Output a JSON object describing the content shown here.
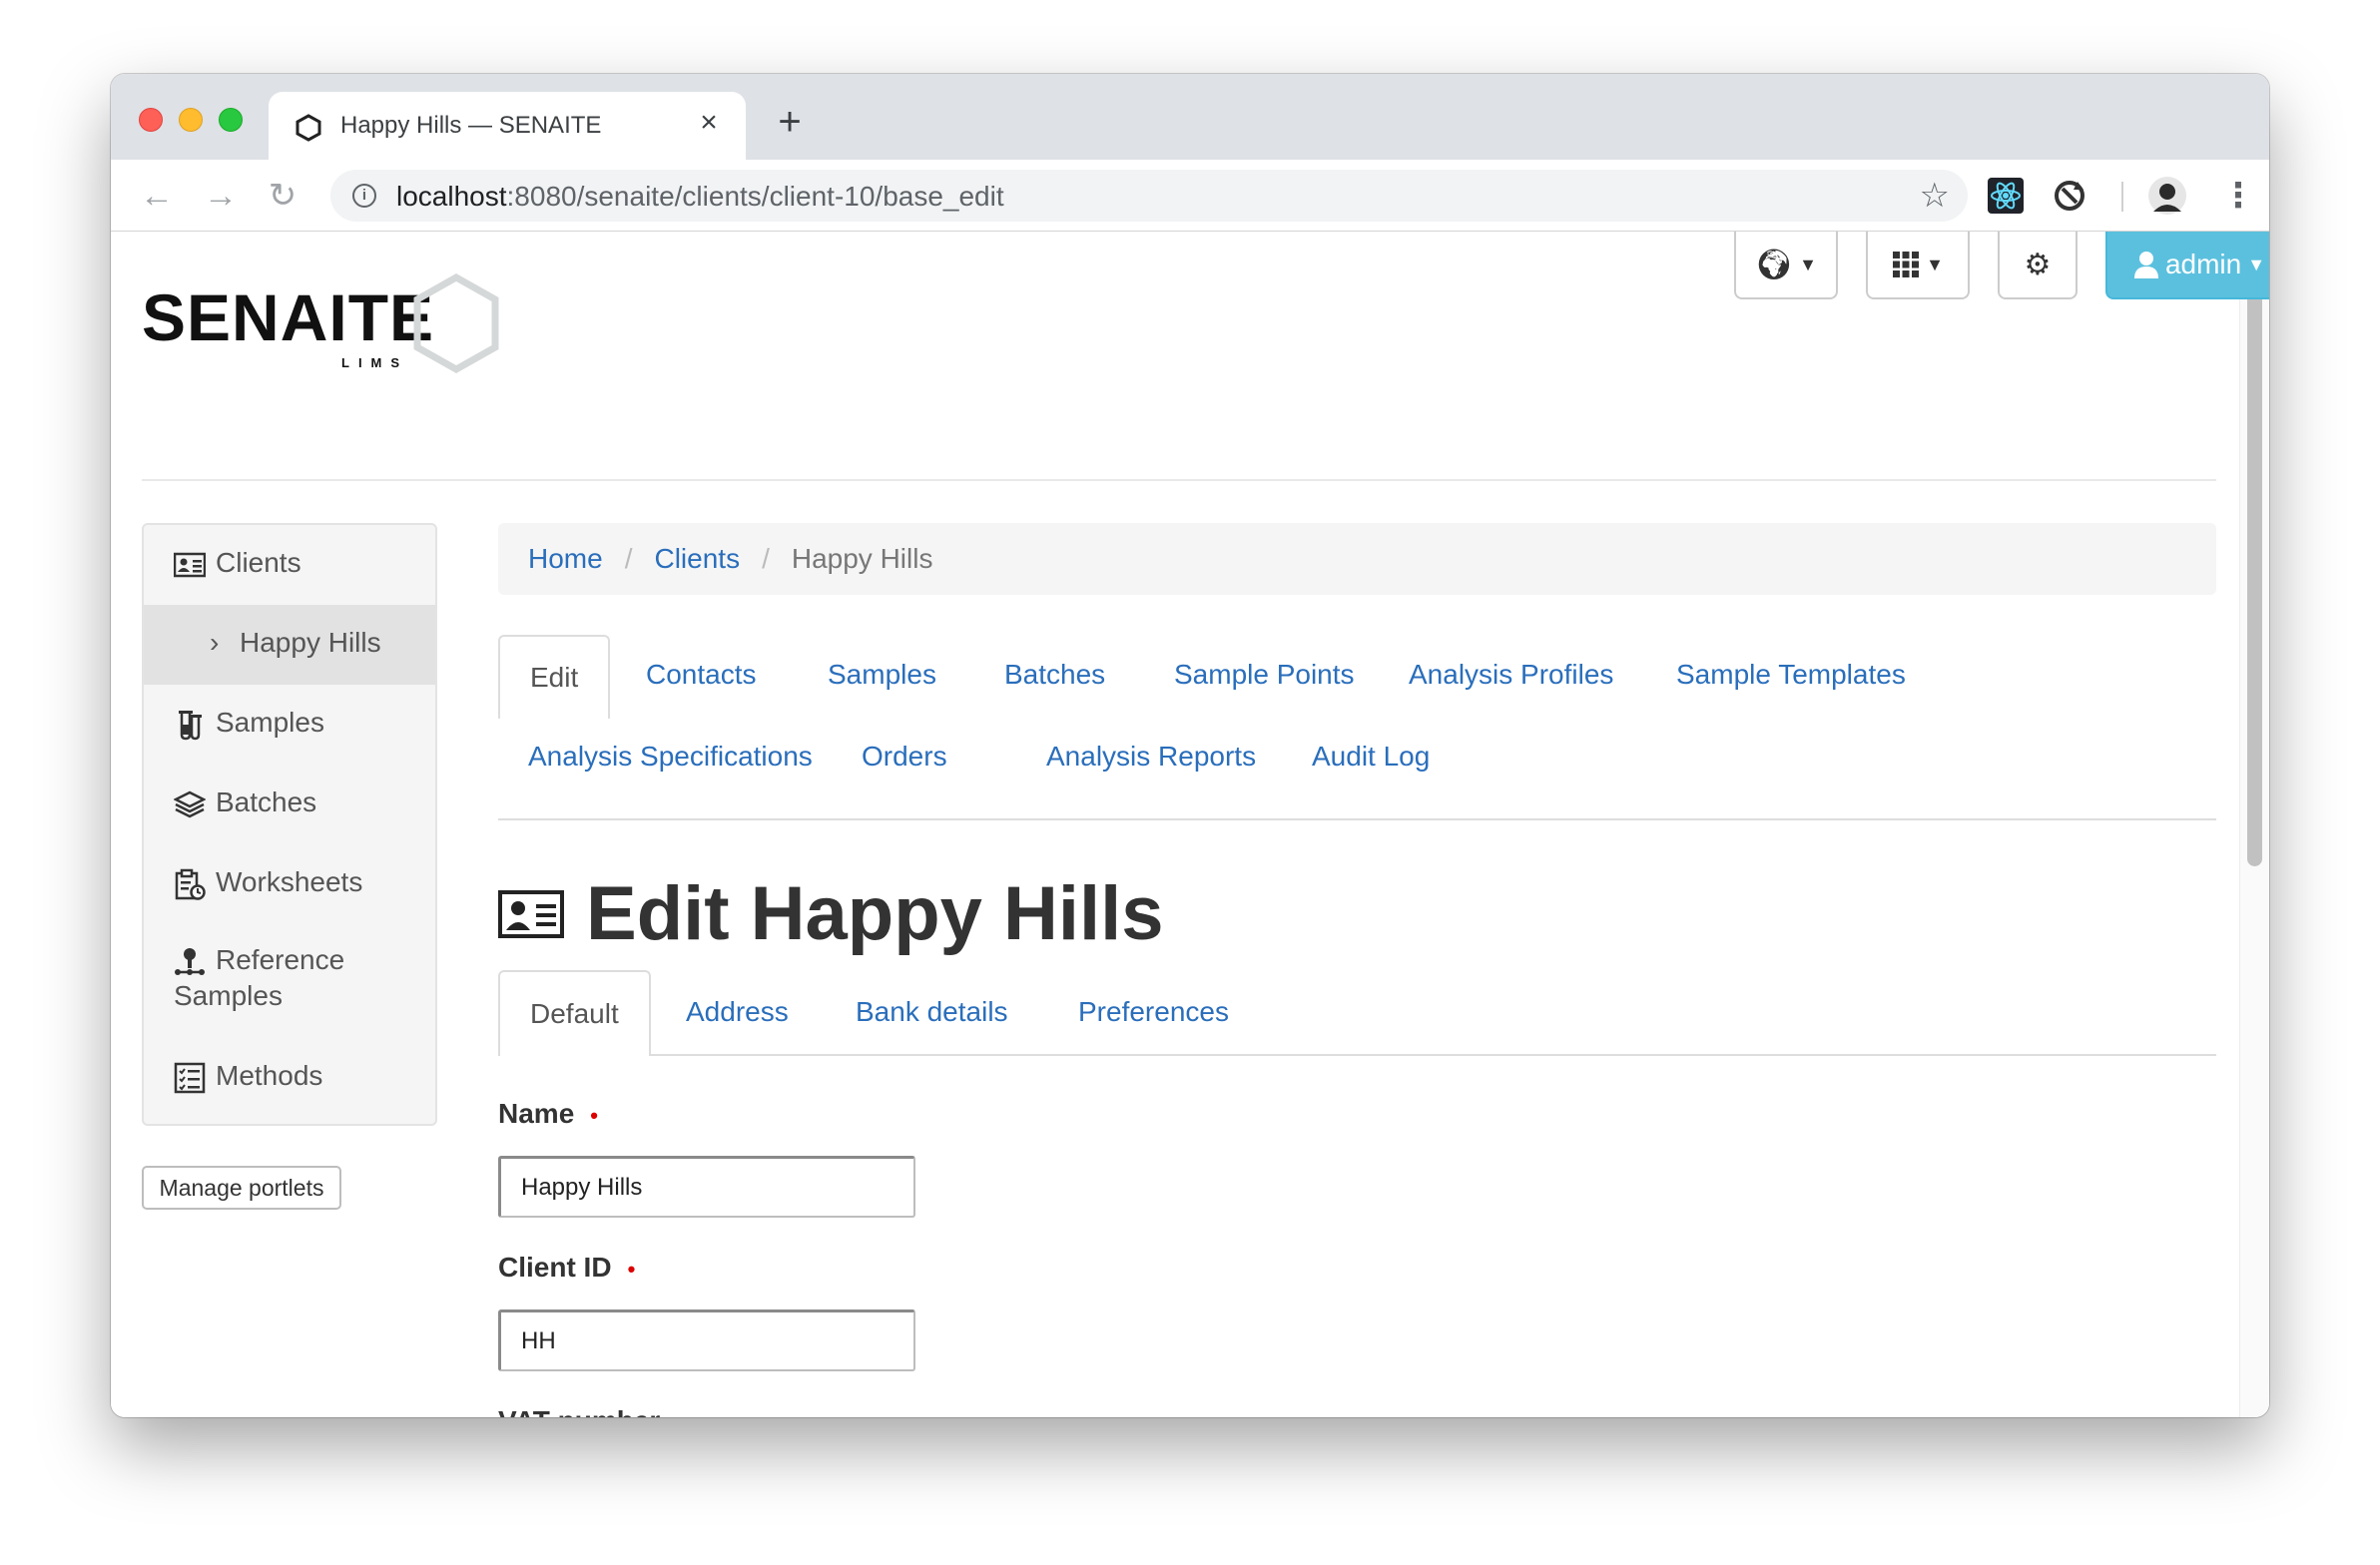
{
  "browser": {
    "tab_title": "Happy Hills — SENAITE",
    "url_host": "localhost",
    "url_path": ":8080/senaite/clients/client-10/base_edit"
  },
  "logo": {
    "name": "SENAITE",
    "sub": "LIMS"
  },
  "topbar": {
    "admin_label": "admin",
    "icons": [
      "globe-icon",
      "grid-icon",
      "gear-icon",
      "user-icon"
    ]
  },
  "sidebar": {
    "items": [
      {
        "label": "Clients",
        "icon": "client-card-icon"
      },
      {
        "label": "Happy Hills",
        "icon": "chevron-right-icon"
      },
      {
        "label": "Samples",
        "icon": "test-tubes-icon"
      },
      {
        "label": "Batches",
        "icon": "layers-icon"
      },
      {
        "label": "Worksheets",
        "icon": "clipboard-clock-icon"
      },
      {
        "label": "Reference",
        "label2": "Samples",
        "icon": "reference-sample-icon"
      },
      {
        "label": "Methods",
        "icon": "checklist-icon"
      }
    ],
    "manage_portlets": "Manage portlets"
  },
  "breadcrumb": {
    "home": "Home",
    "clients": "Clients",
    "current": "Happy Hills"
  },
  "tabs": {
    "row1": [
      "Edit",
      "Contacts",
      "Samples",
      "Batches",
      "Sample Points",
      "Analysis Profiles",
      "Sample Templates"
    ],
    "row2": [
      "Analysis Specifications",
      "Orders",
      "Analysis Reports",
      "Audit Log"
    ]
  },
  "page": {
    "title": "Edit Happy Hills"
  },
  "form_tabs": [
    "Default",
    "Address",
    "Bank details",
    "Preferences"
  ],
  "form": {
    "name_label": "Name",
    "name_value": "Happy Hills",
    "client_id_label": "Client ID",
    "client_id_value": "HH",
    "vat_label": "VAT number",
    "vat_value": "",
    "required_marker": "•"
  },
  "colors": {
    "link": "#2a6ebb",
    "admin_button": "#5bc0de",
    "required": "#dd0000"
  }
}
